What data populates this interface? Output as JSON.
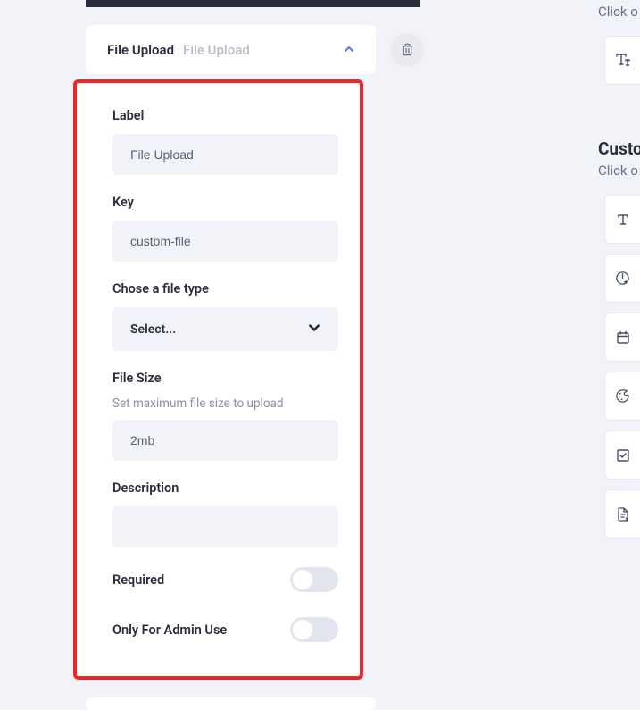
{
  "header": {
    "title": "File Upload",
    "subtitle": "File Upload"
  },
  "form": {
    "label_field": {
      "label": "Label",
      "value": "File Upload"
    },
    "key_field": {
      "label": "Key",
      "value": "custom-file"
    },
    "filetype": {
      "label": "Chose a file type",
      "selected": "Select..."
    },
    "filesize": {
      "label": "File Size",
      "hint": "Set maximum file size to upload",
      "value": "2mb"
    },
    "description": {
      "label": "Description",
      "value": ""
    },
    "required": {
      "label": "Required",
      "on": false
    },
    "admin_only": {
      "label": "Only For Admin Use",
      "on": false
    }
  },
  "right": {
    "hint1": "Click o",
    "custom_heading": "Custo",
    "hint2": "Click o"
  }
}
